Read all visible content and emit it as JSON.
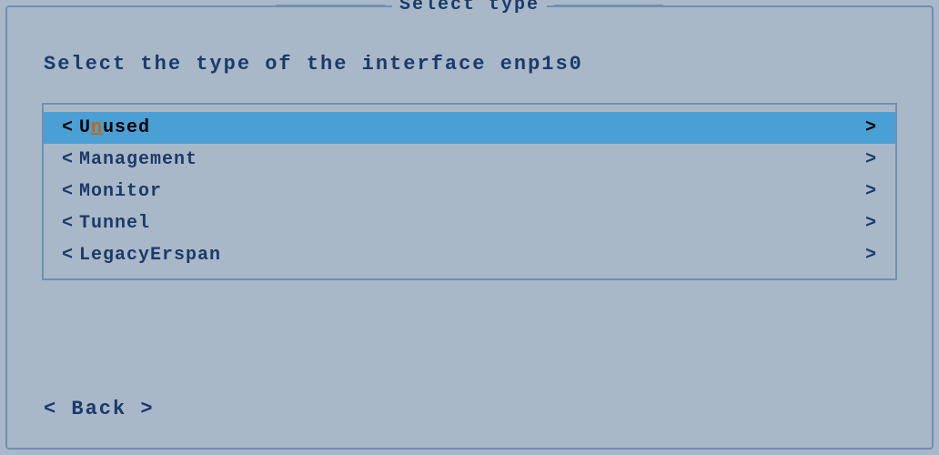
{
  "window": {
    "title": "Select type",
    "subtitle": "Select the type of the interface enp1s0"
  },
  "list": {
    "items": [
      {
        "label": "Unused",
        "selected": true,
        "underline_index": 1
      },
      {
        "label": "Management",
        "selected": false
      },
      {
        "label": "Monitor",
        "selected": false
      },
      {
        "label": "Tunnel",
        "selected": false
      },
      {
        "label": "LegacyErspan",
        "selected": false
      }
    ]
  },
  "back_button": "< Back >",
  "colors": {
    "bg": "#a8b8c8",
    "border": "#7090b0",
    "text_dark": "#1a3a6a",
    "selected_bg": "#4a9fd4",
    "underline_char_color": "#cc6600"
  }
}
